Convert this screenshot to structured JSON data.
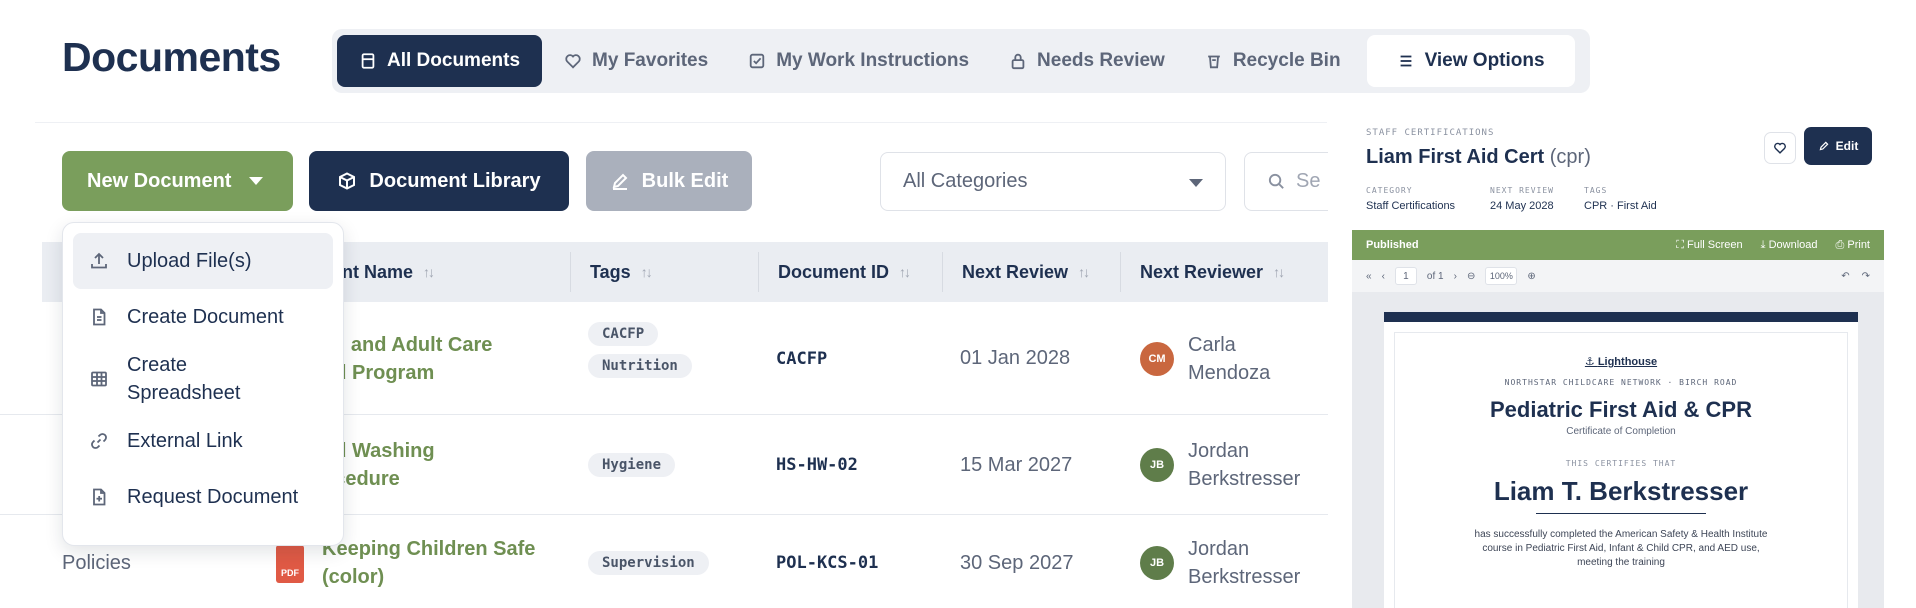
{
  "page": {
    "title": "Documents"
  },
  "tabs": [
    {
      "label": "All Documents",
      "icon": "document-icon"
    },
    {
      "label": "My Favorites",
      "icon": "heart-icon"
    },
    {
      "label": "My Work Instructions",
      "icon": "checklist-icon"
    },
    {
      "label": "Needs Review",
      "icon": "lock-icon"
    },
    {
      "label": "Recycle Bin",
      "icon": "trash-icon"
    },
    {
      "label": "View Options",
      "icon": "menu-icon"
    }
  ],
  "toolbar": {
    "new_document": "New Document",
    "document_library": "Document Library",
    "bulk_edit": "Bulk Edit",
    "category_select": "All Categories",
    "search_placeholder": "Se"
  },
  "new_menu": [
    {
      "label": "Upload File(s)",
      "icon": "upload-icon"
    },
    {
      "label": "Create Document",
      "icon": "file-icon"
    },
    {
      "label": "Create Spreadsheet",
      "icon": "grid-icon"
    },
    {
      "label": "External Link",
      "icon": "link-icon"
    },
    {
      "label": "Request Document",
      "icon": "file-plus-icon"
    }
  ],
  "table": {
    "columns": [
      "ent Name",
      "Tags",
      "Document ID",
      "Next Review",
      "Next Reviewer"
    ],
    "rows": [
      {
        "category": "",
        "name": "ild and Adult Care od Program",
        "name_lines": [
          "ild and Adult Care",
          "od Program"
        ],
        "tags": [
          "CACFP",
          "Nutrition"
        ],
        "doc_id": "CACFP",
        "next_review": "01 Jan 2028",
        "reviewer_initials": "CM",
        "reviewer_lines": [
          "Carla",
          "Mendoza"
        ]
      },
      {
        "category": "",
        "name": "nd Washing ocedure",
        "name_lines": [
          "nd Washing",
          "ocedure"
        ],
        "tags": [
          "Hygiene"
        ],
        "doc_id": "HS-HW-02",
        "next_review": "15 Mar 2027",
        "reviewer_initials": "JB",
        "reviewer_lines": [
          "Jordan",
          "Berkstresser"
        ]
      },
      {
        "category": "Policies",
        "name": "Keeping Children Safe (color)",
        "name_lines": [
          "Keeping Children Safe",
          "(color)"
        ],
        "file_badge": "PDF",
        "tags": [
          "Supervision"
        ],
        "doc_id": "POL-KCS-01",
        "next_review": "30 Sep 2027",
        "reviewer_initials": "JB",
        "reviewer_lines": [
          "Jordan",
          "Berkstresser"
        ]
      }
    ]
  },
  "preview": {
    "category_caption": "STAFF CERTIFICATIONS",
    "title": "Liam First Aid Cert",
    "title_suffix": "(cpr)",
    "edit_label": "Edit",
    "meta": [
      {
        "label": "CATEGORY",
        "value": "Staff Certifications"
      },
      {
        "label": "NEXT REVIEW",
        "value": "24 May 2028"
      },
      {
        "label": "TAGS",
        "value": "CPR · First Aid"
      }
    ],
    "status": "Published",
    "actions": [
      "Full Screen",
      "Download",
      "Print"
    ],
    "page_current": "1",
    "page_total": "of 1",
    "zoom": "100%",
    "certificate": {
      "logo": "Lighthouse",
      "org": "NORTHSTAR CHILDCARE NETWORK · BIRCH ROAD",
      "title": "Pediatric First Aid & CPR",
      "subtitle": "Certificate of Completion",
      "certifies": "THIS CERTIFIES THAT",
      "name": "Liam T. Berkstresser",
      "body": "has successfully completed the American Safety & Health Institute course in Pediatric First Aid, Infant & Child CPR, and AED use, meeting the training"
    }
  },
  "colors": {
    "navy": "#1e3050",
    "green": "#7a9e5c",
    "avatar_cm": "#c9673f",
    "avatar_jb": "#5f7d4a",
    "pdf": "#e05a45"
  }
}
